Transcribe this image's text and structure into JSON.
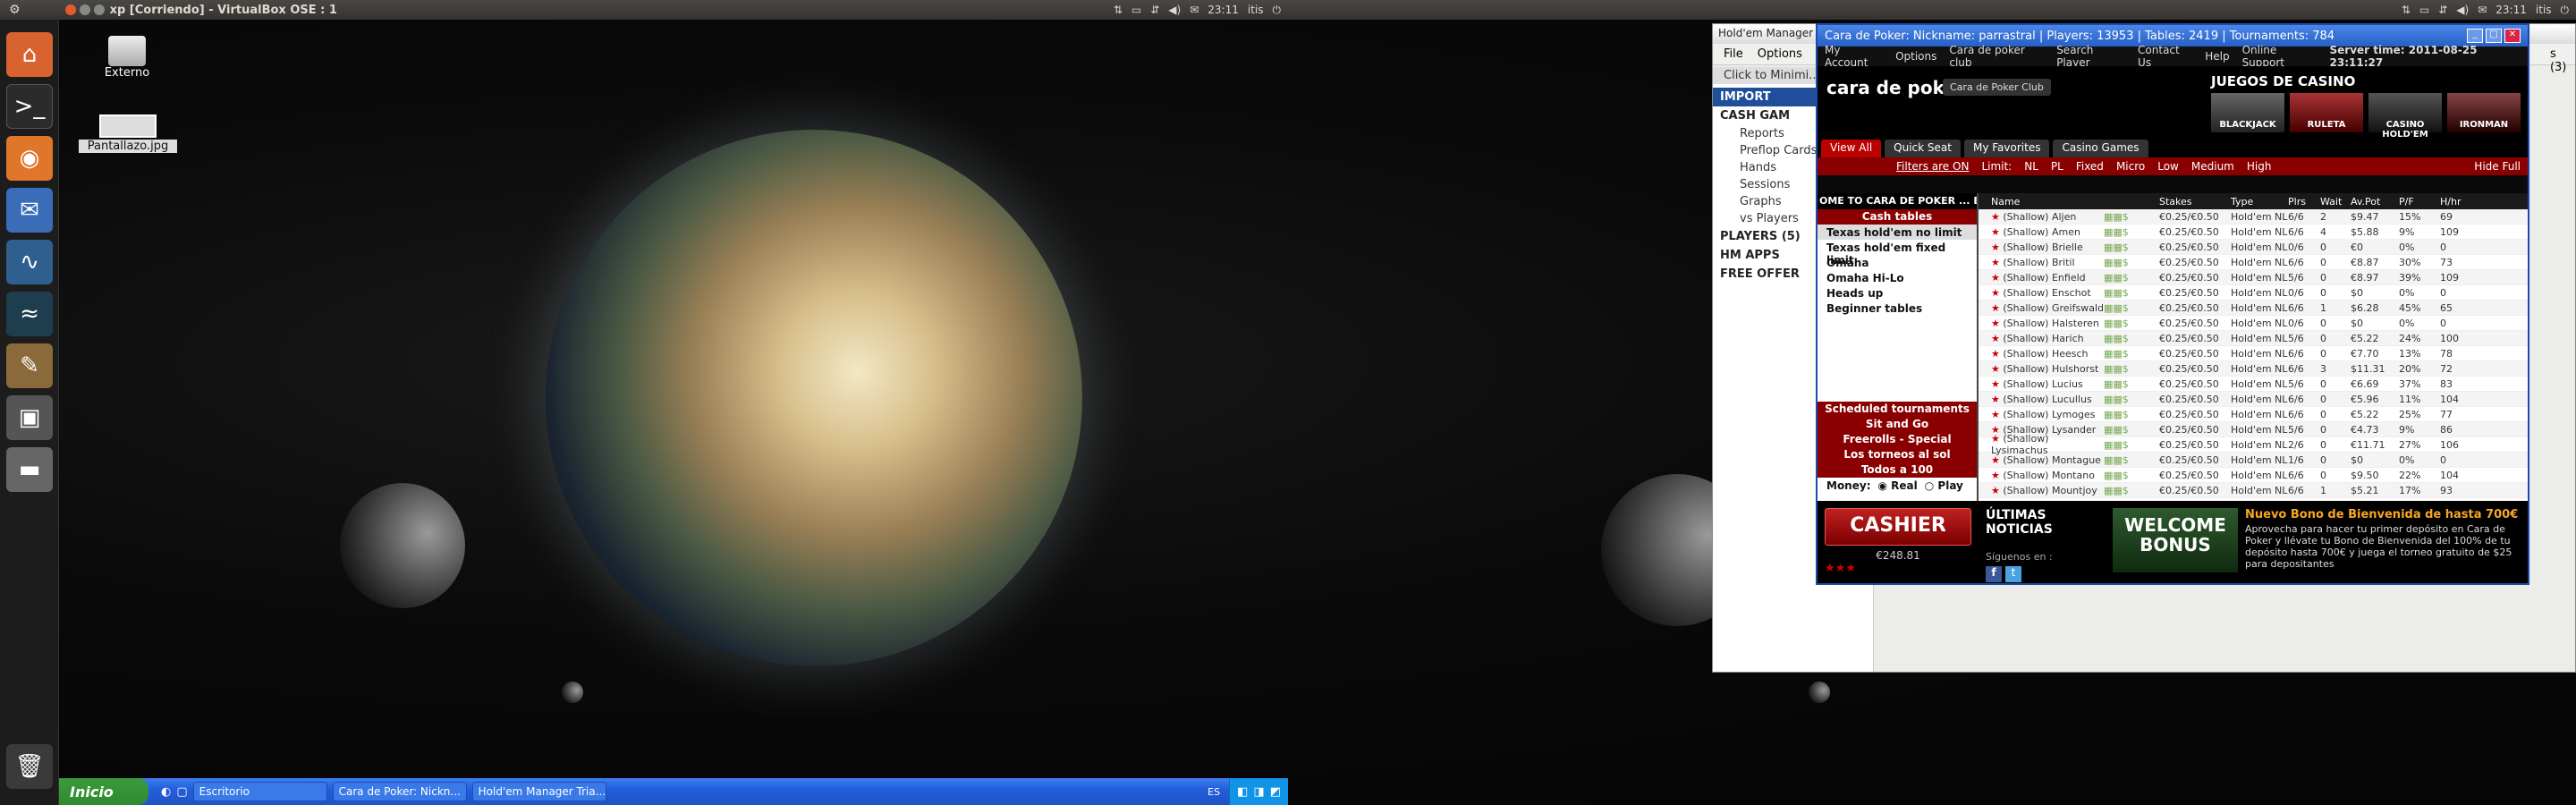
{
  "ubuntu_panel": {
    "left_title": "xp [Corriendo] - VirtualBox OSE : 1",
    "right_time": "23:11",
    "right_user": "itis",
    "right2_time": "23:11",
    "right2_user": "itis"
  },
  "desktop_icons": [
    {
      "label": "Externo"
    },
    {
      "label": "Pantallazo.jpg"
    }
  ],
  "xp_taskbar": {
    "start_label": "Inicio",
    "tasks": [
      "Escritorio",
      "Cara de Poker: Nickn...",
      "Hold'em Manager Tria..."
    ],
    "tray_lang": "ES"
  },
  "holdem_manager": {
    "title": "Hold'em Manager",
    "menu": [
      "File",
      "Options"
    ],
    "click_min": "Click to Minimi...",
    "import": "IMPORT",
    "cash_games": "CASH GAM",
    "nav": [
      "Reports",
      "Preflop Cards",
      "Hands",
      "Sessions",
      "Graphs",
      "vs Players"
    ],
    "players": "PLAYERS (5)",
    "hm_apps": "HM APPS",
    "free_offer": "FREE OFFER",
    "tab_right": "s (3)"
  },
  "poker": {
    "title": "Cara de Poker: Nickname: parrastral | Players: 13953 | Tables: 2419 | Tournaments: 784",
    "menu": [
      "My Account",
      "Options",
      "Cara de poker club",
      "Search Player",
      "Contact Us",
      "Help",
      "Online Support"
    ],
    "server_time": "Server time: 2011-08-25 23:11:27",
    "logo": "cara de poker",
    "club_btn": "Cara de Poker Club",
    "casino_title": "JUEGOS DE CASINO",
    "casino_games": [
      "BLACKJACK",
      "RULETA",
      "CASINO HOLD'EM",
      "IRONMAN"
    ],
    "tabs": [
      "View All",
      "Quick Seat",
      "My Favorites",
      "Casino Games"
    ],
    "filters": "Filters are ON",
    "limit": "Limit:",
    "limits": [
      "NL",
      "PL",
      "Fixed",
      "Micro",
      "Low",
      "Medium",
      "High"
    ],
    "hide_full": "Hide Full",
    "welcome": "OME TO CARA DE POKER ... E",
    "left_sections": {
      "cash_tables": "Cash tables",
      "cash_items": [
        "Texas hold'em no limit",
        "Texas hold'em fixed limit",
        "Omaha",
        "Omaha Hi-Lo",
        "Heads up",
        "Beginner tables"
      ],
      "tourney_items": [
        "Scheduled tournaments",
        "Sit and Go",
        "Freerolls - Special",
        "Los torneos al sol",
        "Todos a 100"
      ],
      "money": "Money:",
      "real": "Real",
      "play": "Play"
    },
    "columns": [
      "Name",
      "Stakes",
      "Type",
      "Plrs",
      "Wait",
      "Av.Pot",
      "P/F",
      "H/hr"
    ],
    "rows": [
      [
        "(Shallow) Aljen",
        "€0.25/€0.50",
        "Hold'em NL",
        "6/6",
        "2",
        "$9.47",
        "15%",
        "69"
      ],
      [
        "(Shallow) Amen",
        "€0.25/€0.50",
        "Hold'em NL",
        "6/6",
        "4",
        "$5.88",
        "9%",
        "109"
      ],
      [
        "(Shallow) Brielle",
        "€0.25/€0.50",
        "Hold'em NL",
        "0/6",
        "0",
        "€0",
        "0%",
        "0"
      ],
      [
        "(Shallow) Britil",
        "€0.25/€0.50",
        "Hold'em NL",
        "6/6",
        "0",
        "€8.87",
        "30%",
        "73"
      ],
      [
        "(Shallow) Enfield",
        "€0.25/€0.50",
        "Hold'em NL",
        "5/6",
        "0",
        "€8.97",
        "39%",
        "109"
      ],
      [
        "(Shallow) Enschot",
        "€0.25/€0.50",
        "Hold'em NL",
        "0/6",
        "0",
        "$0",
        "0%",
        "0"
      ],
      [
        "(Shallow) Greifswald",
        "€0.25/€0.50",
        "Hold'em NL",
        "6/6",
        "1",
        "$6.28",
        "45%",
        "65"
      ],
      [
        "(Shallow) Halsteren",
        "€0.25/€0.50",
        "Hold'em NL",
        "0/6",
        "0",
        "$0",
        "0%",
        "0"
      ],
      [
        "(Shallow) Harich",
        "€0.25/€0.50",
        "Hold'em NL",
        "5/6",
        "0",
        "€5.22",
        "24%",
        "100"
      ],
      [
        "(Shallow) Heesch",
        "€0.25/€0.50",
        "Hold'em NL",
        "6/6",
        "0",
        "€7.70",
        "13%",
        "78"
      ],
      [
        "(Shallow) Hulshorst",
        "€0.25/€0.50",
        "Hold'em NL",
        "6/6",
        "3",
        "$11.31",
        "20%",
        "72"
      ],
      [
        "(Shallow) Lucius",
        "€0.25/€0.50",
        "Hold'em NL",
        "5/6",
        "0",
        "€6.69",
        "37%",
        "83"
      ],
      [
        "(Shallow) Lucullus",
        "€0.25/€0.50",
        "Hold'em NL",
        "6/6",
        "0",
        "€5.96",
        "11%",
        "104"
      ],
      [
        "(Shallow) Lymoges",
        "€0.25/€0.50",
        "Hold'em NL",
        "6/6",
        "0",
        "€5.22",
        "25%",
        "77"
      ],
      [
        "(Shallow) Lysander",
        "€0.25/€0.50",
        "Hold'em NL",
        "5/6",
        "0",
        "€4.73",
        "9%",
        "86"
      ],
      [
        "(Shallow) Lysimachus",
        "€0.25/€0.50",
        "Hold'em NL",
        "2/6",
        "0",
        "€11.71",
        "27%",
        "106"
      ],
      [
        "(Shallow) Montague",
        "€0.25/€0.50",
        "Hold'em NL",
        "1/6",
        "0",
        "$0",
        "0%",
        "0"
      ],
      [
        "(Shallow) Montano",
        "€0.25/€0.50",
        "Hold'em NL",
        "6/6",
        "0",
        "$9.50",
        "22%",
        "104"
      ],
      [
        "(Shallow) Mountjoy",
        "€0.25/€0.50",
        "Hold'em NL",
        "6/6",
        "1",
        "$5.21",
        "17%",
        "93"
      ]
    ],
    "cashier": "CASHIER",
    "balance": "€248.81",
    "news_title": "ÚLTIMAS NOTICIAS",
    "follow": "Síguenos en :",
    "welcome_bonus": "WELCOME BONUS",
    "bonus_title": "Nuevo Bono de Bienvenida de hasta 700€",
    "bonus_text": "Aprovecha para hacer tu primer depósito en Cara de Poker y llévate tu Bono de Bienvenida del 100% de tu depósito hasta 700€ y juega el torneo gratuito de $25 para depositantes"
  },
  "colors": {
    "xp_blue": "#245edb",
    "poker_red": "#8a0000",
    "xp_green": "#3c9a3c"
  }
}
